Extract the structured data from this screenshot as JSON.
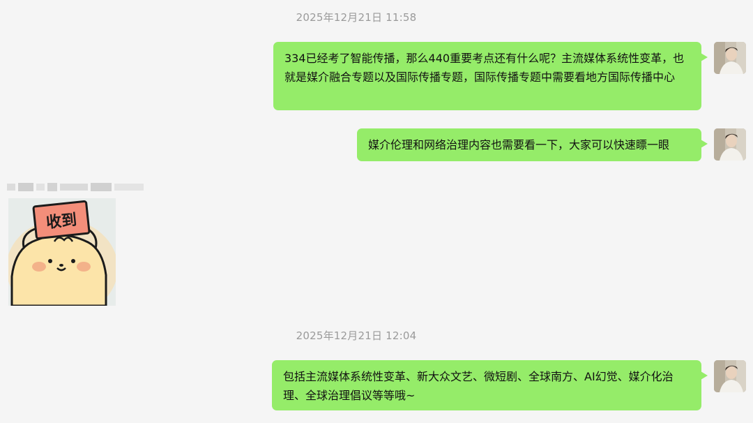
{
  "messages": {
    "ts1": "2025年12月21日 11:58",
    "msg1": "334已经考了智能传播，那么440重要考点还有什么呢？主流媒体系统性变革，也就是媒介融合专题以及国际传播专题，国际传播专题中需要看地方国际传播中心",
    "msg2": "媒介伦理和网络治理内容也需要看一下，大家可以快速瞟一眼",
    "sticker_text": "收到",
    "ts2": "2025年12月21日 12:04",
    "msg3": "包括主流媒体系统性变革、新大众文艺、微短剧、全球南方、AI幻觉、媒介化治理、全球治理倡议等等哦~"
  },
  "colors": {
    "bubble_self": "#95ec69",
    "background": "#f5f5f5",
    "timestamp": "#9a9a9a"
  }
}
